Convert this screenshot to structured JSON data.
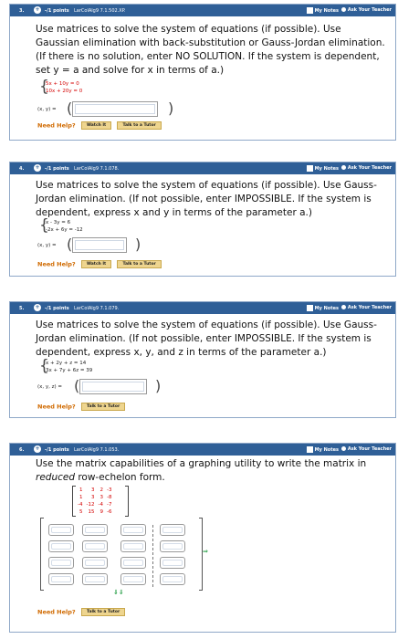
{
  "header": {
    "my_notes": "My Notes",
    "ask_teacher": "Ask Your Teacher"
  },
  "help": {
    "label": "Need Help?",
    "watch": "Watch It",
    "tutor": "Talk to a Tutor"
  },
  "q3": {
    "number": "3.",
    "points": "-/1 points",
    "source": "LarColAlg9 7.1.502.XP.",
    "text": "Use matrices to solve the system of equations (if possible). Use Gaussian elimination with back-substitution or Gauss-Jordan elimination. (If there is no solution, enter NO SOLUTION. If the system is dependent, set y = a and solve for x in terms of a.)",
    "eq1": "5x + 10y = 0",
    "eq2": "10x + 20y = 0",
    "answer_label": "(x, y) ="
  },
  "q4": {
    "number": "4.",
    "points": "-/1 points",
    "source": "LarColAlg9 7.1.078.",
    "text": "Use matrices to solve the system of equations (if possible). Use Gauss-Jordan elimination. (If not possible, enter IMPOSSIBLE. If the system is dependent, express x and y in terms of the parameter a.)",
    "eq1": "x - 3y = 6",
    "eq2": "-2x + 6y = -12",
    "answer_label": "(x, y) ="
  },
  "q5": {
    "number": "5.",
    "points": "-/1 points",
    "source": "LarColAlg9 7.1.079.",
    "text": "Use matrices to solve the system of equations (if possible). Use Gauss-Jordan elimination. (If not possible, enter IMPOSSIBLE. If the system is dependent, express x, y, and z in terms of the parameter a.)",
    "eq1": "x + 2y + z = 14",
    "eq2": "3x + 7y + 6z = 39",
    "answer_label": "(x, y, z) ="
  },
  "q6": {
    "number": "6.",
    "points": "-/1 points",
    "source": "LarColAlg9 7.1.053.",
    "text_a": "Use the matrix capabilities of a graphing utility to write the matrix in ",
    "text_em": "reduced",
    "text_b": " row-echelon form.",
    "matrix": [
      [
        "1",
        "3",
        "2",
        "-3"
      ],
      [
        "1",
        "3",
        "3",
        "-8"
      ],
      [
        "-4",
        "-12",
        "-4",
        "-7"
      ],
      [
        "5",
        "15",
        "9",
        "-6"
      ]
    ],
    "arrows_right": "⇒",
    "arrows_down": "⇓⇓"
  }
}
